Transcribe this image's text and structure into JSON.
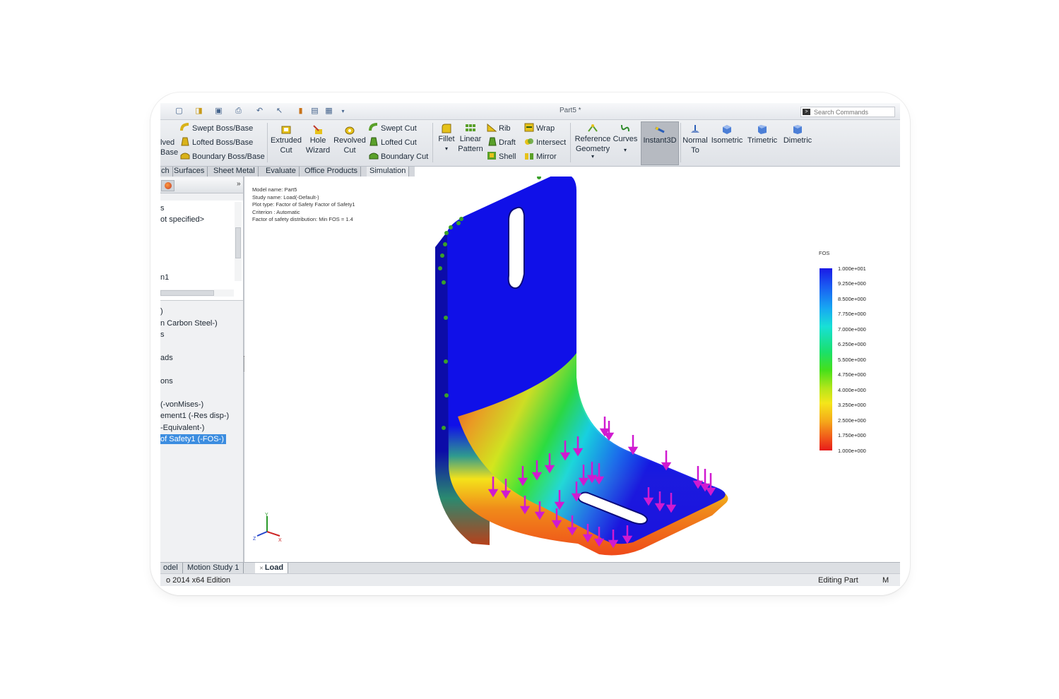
{
  "app": {
    "doc_title": "Part5 *",
    "search_placeholder": "Search Commands"
  },
  "ribbon": {
    "revolved_base": [
      "lved",
      "Base"
    ],
    "swept_boss": "Swept Boss/Base",
    "lofted_boss": "Lofted Boss/Base",
    "boundary_boss": "Boundary Boss/Base",
    "extruded_cut": [
      "Extruded",
      "Cut"
    ],
    "hole_wizard": [
      "Hole",
      "Wizard"
    ],
    "revolved_cut": [
      "Revolved",
      "Cut"
    ],
    "swept_cut": "Swept Cut",
    "lofted_cut": "Lofted Cut",
    "boundary_cut": "Boundary Cut",
    "fillet": "Fillet",
    "linear_pattern": [
      "Linear",
      "Pattern"
    ],
    "rib": "Rib",
    "draft": "Draft",
    "shell": "Shell",
    "wrap": "Wrap",
    "intersect": "Intersect",
    "mirror": "Mirror",
    "reference_geometry": [
      "Reference",
      "Geometry"
    ],
    "curves": "Curves",
    "instant3d": "Instant3D",
    "normal_to": [
      "Normal",
      "To"
    ],
    "isometric": "Isometric",
    "trimetric": "Trimetric",
    "dimetric": "Dimetric"
  },
  "tabs": [
    "ch",
    "Surfaces",
    "Sheet Metal",
    "Evaluate",
    "Office Products",
    "Simulation"
  ],
  "tree_upper": [
    "s",
    "ot specified>",
    "n1"
  ],
  "tree_lower": [
    ")",
    "n Carbon Steel-)",
    "s",
    "ads",
    "ons",
    "(-vonMises-)",
    "ement1 (-Res disp-)",
    "-Equivalent-)"
  ],
  "tree_selected": "of Safety1 (-FOS-)",
  "plot_info": [
    "Model name: Part5",
    "Study name: Load(-Default-)",
    "Plot type: Factor of Safety Factor of Safety1",
    "Criterion : Automatic",
    "Factor of safety distribution: Min FOS = 1.4"
  ],
  "legend": {
    "title": "FOS",
    "labels": [
      "1.000e+001",
      "9.250e+000",
      "8.500e+000",
      "7.750e+000",
      "7.000e+000",
      "6.250e+000",
      "5.500e+000",
      "4.750e+000",
      "4.000e+000",
      "3.250e+000",
      "2.500e+000",
      "1.750e+000",
      "1.000e+000"
    ],
    "colors": {
      "max": "#1a1ae6",
      "mid": "#46e01a",
      "min": "#e61a1a"
    }
  },
  "triad_labels": {
    "y": "Y",
    "x": "X",
    "z": "Z"
  },
  "bottom_tabs": [
    "odel",
    "Motion Study 1",
    "Load"
  ],
  "status": {
    "edition": "o 2014 x64 Edition",
    "mode": "Editing Part",
    "units": "M"
  }
}
